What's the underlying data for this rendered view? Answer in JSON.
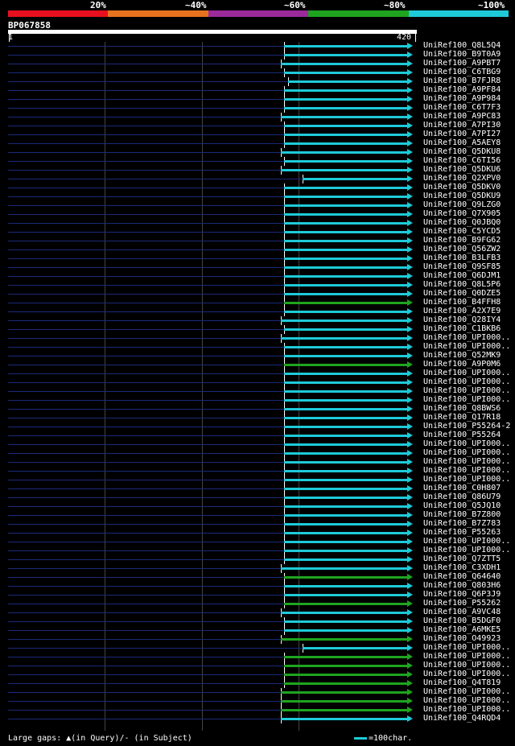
{
  "legend": {
    "labels": [
      "20%",
      "~40%",
      "~60%",
      "~80%",
      "~100%"
    ],
    "colors": [
      "#e8101e",
      "#e8731e",
      "#9b2a9b",
      "#1fa41f",
      "#1ecad8"
    ]
  },
  "query": {
    "name": "BP067858",
    "start": "1",
    "end": "420"
  },
  "footer": {
    "gaps_text": "Large gaps: ▲(in Query)/- (in Subject)",
    "scale_text": "=100char."
  },
  "hits": [
    {
      "name": "UniRef100_Q8L5Q4",
      "start": 0.684,
      "color": "#1ecad8"
    },
    {
      "name": "UniRef100_B9T0A9",
      "start": 0.684,
      "color": "#1ecad8"
    },
    {
      "name": "UniRef100_A9PBT7",
      "start": 0.676,
      "color": "#1ecad8"
    },
    {
      "name": "UniRef100_C6TBG9",
      "start": 0.684,
      "color": "#1ecad8"
    },
    {
      "name": "UniRef100_B7FJR8",
      "start": 0.694,
      "color": "#1ecad8"
    },
    {
      "name": "UniRef100_A9PF84",
      "start": 0.684,
      "color": "#1ecad8"
    },
    {
      "name": "UniRef100_A9P984",
      "start": 0.684,
      "color": "#1ecad8"
    },
    {
      "name": "UniRef100_C6T7F3",
      "start": 0.684,
      "color": "#1ecad8"
    },
    {
      "name": "UniRef100_A9PC83",
      "start": 0.676,
      "color": "#1ecad8"
    },
    {
      "name": "UniRef100_A7PI30",
      "start": 0.684,
      "color": "#1ecad8"
    },
    {
      "name": "UniRef100_A7PI27",
      "start": 0.684,
      "color": "#1ecad8"
    },
    {
      "name": "UniRef100_A5AEY8",
      "start": 0.684,
      "color": "#1ecad8"
    },
    {
      "name": "UniRef100_Q5DKU8",
      "start": 0.676,
      "color": "#1ecad8"
    },
    {
      "name": "UniRef100_C6TI56",
      "start": 0.684,
      "color": "#1ecad8"
    },
    {
      "name": "UniRef100_Q5DKU6",
      "start": 0.676,
      "color": "#1ecad8"
    },
    {
      "name": "UniRef100_Q2XPV0",
      "start": 0.73,
      "color": "#1ecad8"
    },
    {
      "name": "UniRef100_Q5DKV0",
      "start": 0.684,
      "color": "#1ecad8"
    },
    {
      "name": "UniRef100_Q5DKU9",
      "start": 0.684,
      "color": "#1ecad8"
    },
    {
      "name": "UniRef100_Q9LZG0",
      "start": 0.684,
      "color": "#1ecad8"
    },
    {
      "name": "UniRef100_Q7X905",
      "start": 0.684,
      "color": "#1ecad8"
    },
    {
      "name": "UniRef100_Q0JBQ0",
      "start": 0.684,
      "color": "#1ecad8"
    },
    {
      "name": "UniRef100_C5YCD5",
      "start": 0.684,
      "color": "#1ecad8"
    },
    {
      "name": "UniRef100_B9FG62",
      "start": 0.684,
      "color": "#1ecad8"
    },
    {
      "name": "UniRef100_Q56ZW2",
      "start": 0.684,
      "color": "#1ecad8"
    },
    {
      "name": "UniRef100_B3LFB3",
      "start": 0.684,
      "color": "#1ecad8"
    },
    {
      "name": "UniRef100_Q9SF85",
      "start": 0.684,
      "color": "#1ecad8"
    },
    {
      "name": "UniRef100_Q6DJM1",
      "start": 0.684,
      "color": "#1ecad8"
    },
    {
      "name": "UniRef100_Q8L5P6",
      "start": 0.684,
      "color": "#1ecad8"
    },
    {
      "name": "UniRef100_Q0DZE5",
      "start": 0.684,
      "color": "#1ecad8"
    },
    {
      "name": "UniRef100_B4FFH8",
      "start": 0.684,
      "color": "#1fa41f"
    },
    {
      "name": "UniRef100_A2X7E9",
      "start": 0.684,
      "color": "#1ecad8"
    },
    {
      "name": "UniRef100_Q28IY4",
      "start": 0.676,
      "color": "#1ecad8"
    },
    {
      "name": "UniRef100_C1BKB6",
      "start": 0.684,
      "color": "#1ecad8"
    },
    {
      "name": "UniRef100_UPI000..",
      "start": 0.676,
      "color": "#1ecad8"
    },
    {
      "name": "UniRef100_UPI000..",
      "start": 0.684,
      "color": "#1ecad8"
    },
    {
      "name": "UniRef100_Q52MK9",
      "start": 0.684,
      "color": "#1ecad8"
    },
    {
      "name": "UniRef100_A9P0M6",
      "start": 0.684,
      "color": "#1fa41f"
    },
    {
      "name": "UniRef100_UPI000..",
      "start": 0.684,
      "color": "#1ecad8"
    },
    {
      "name": "UniRef100_UPI000..",
      "start": 0.684,
      "color": "#1ecad8"
    },
    {
      "name": "UniRef100_UPI000..",
      "start": 0.684,
      "color": "#1ecad8"
    },
    {
      "name": "UniRef100_UPI000..",
      "start": 0.684,
      "color": "#1ecad8"
    },
    {
      "name": "UniRef100_Q8BWS6",
      "start": 0.684,
      "color": "#1ecad8"
    },
    {
      "name": "UniRef100_Q17R18",
      "start": 0.684,
      "color": "#1ecad8"
    },
    {
      "name": "UniRef100_P55264-2",
      "start": 0.684,
      "color": "#1ecad8"
    },
    {
      "name": "UniRef100_P55264",
      "start": 0.684,
      "color": "#1ecad8"
    },
    {
      "name": "UniRef100_UPI000..",
      "start": 0.684,
      "color": "#1ecad8"
    },
    {
      "name": "UniRef100_UPI000..",
      "start": 0.684,
      "color": "#1ecad8"
    },
    {
      "name": "UniRef100_UPI000..",
      "start": 0.684,
      "color": "#1ecad8"
    },
    {
      "name": "UniRef100_UPI000..",
      "start": 0.684,
      "color": "#1ecad8"
    },
    {
      "name": "UniRef100_UPI000..",
      "start": 0.684,
      "color": "#1ecad8"
    },
    {
      "name": "UniRef100_C0H807",
      "start": 0.684,
      "color": "#1ecad8"
    },
    {
      "name": "UniRef100_Q86U79",
      "start": 0.684,
      "color": "#1ecad8"
    },
    {
      "name": "UniRef100_Q5JQ10",
      "start": 0.684,
      "color": "#1ecad8"
    },
    {
      "name": "UniRef100_B7Z800",
      "start": 0.684,
      "color": "#1ecad8"
    },
    {
      "name": "UniRef100_B7Z783",
      "start": 0.684,
      "color": "#1ecad8"
    },
    {
      "name": "UniRef100_P55263",
      "start": 0.684,
      "color": "#1ecad8"
    },
    {
      "name": "UniRef100_UPI000..",
      "start": 0.684,
      "color": "#1ecad8"
    },
    {
      "name": "UniRef100_UPI000..",
      "start": 0.684,
      "color": "#1ecad8"
    },
    {
      "name": "UniRef100_Q7ZTT5",
      "start": 0.684,
      "color": "#1ecad8"
    },
    {
      "name": "UniRef100_C3XDH1",
      "start": 0.676,
      "color": "#1ecad8"
    },
    {
      "name": "UniRef100_Q64640",
      "start": 0.684,
      "color": "#1fa41f"
    },
    {
      "name": "UniRef100_Q803H6",
      "start": 0.684,
      "color": "#1ecad8"
    },
    {
      "name": "UniRef100_Q6P3J9",
      "start": 0.684,
      "color": "#1ecad8"
    },
    {
      "name": "UniRef100_P55262",
      "start": 0.684,
      "color": "#1fa41f"
    },
    {
      "name": "UniRef100_A9VC48",
      "start": 0.676,
      "color": "#1ecad8"
    },
    {
      "name": "UniRef100_B5DGF0",
      "start": 0.684,
      "color": "#1ecad8"
    },
    {
      "name": "UniRef100_A6MKE5",
      "start": 0.684,
      "color": "#1ecad8"
    },
    {
      "name": "UniRef100_O49923",
      "start": 0.676,
      "color": "#1fa41f"
    },
    {
      "name": "UniRef100_UPI000..",
      "start": 0.73,
      "color": "#1ecad8"
    },
    {
      "name": "UniRef100_UPI000..",
      "start": 0.684,
      "color": "#1fa41f"
    },
    {
      "name": "UniRef100_UPI000..",
      "start": 0.684,
      "color": "#1fa41f"
    },
    {
      "name": "UniRef100_UPI000..",
      "start": 0.684,
      "color": "#1fa41f"
    },
    {
      "name": "UniRef100_Q4T819",
      "start": 0.684,
      "color": "#1fa41f"
    },
    {
      "name": "UniRef100_UPI000..",
      "start": 0.676,
      "color": "#1fa41f"
    },
    {
      "name": "UniRef100_UPI000..",
      "start": 0.676,
      "color": "#1fa41f"
    },
    {
      "name": "UniRef100_UPI000..",
      "start": 0.676,
      "color": "#1fa41f"
    },
    {
      "name": "UniRef100_Q4RQD4",
      "start": 0.676,
      "color": "#1ecad8"
    }
  ]
}
